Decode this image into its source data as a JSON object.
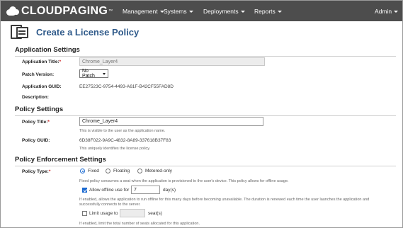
{
  "navbar": {
    "brand": "CLOUDPAGING",
    "brand_mark": "™",
    "items": [
      {
        "label": "Management"
      },
      {
        "label": "Systems"
      },
      {
        "label": "Deployments"
      },
      {
        "label": "Reports"
      },
      {
        "label": "Admin"
      }
    ]
  },
  "page": {
    "title": "Create a License Policy",
    "icon": "license-documents-icon"
  },
  "application_settings": {
    "heading": "Application Settings",
    "title_label": "Application Title:",
    "title_value": "Chrome_Layer4",
    "patch_label": "Patch Version:",
    "patch_value": "No Patch",
    "guid_label": "Application GUID:",
    "guid_value": "EE27523C-9754-4493-A61F-B42CF55FAD8D",
    "description_label": "Description:"
  },
  "policy_settings": {
    "heading": "Policy Settings",
    "title_label": "Policy Title:",
    "title_value": "Chrome_Layer4",
    "title_hint": "This is visible to the user as the application name.",
    "guid_label": "Policy GUID:",
    "guid_value": "6D38F022-9A9C-4832-8A89-337618B37F83",
    "guid_hint": "This uniquely identifies the license policy."
  },
  "enforcement": {
    "heading": "Policy Enforcement Settings",
    "type_label": "Policy Type:",
    "types": [
      {
        "label": "Fixed",
        "selected": true
      },
      {
        "label": "Floating",
        "selected": false
      },
      {
        "label": "Metered-only",
        "selected": false
      }
    ],
    "type_hint": "Fixed policy consumes a seat when the application is provisioned to the user's device. This policy allows for offline usage.",
    "offline_label": "Allow offline use for",
    "offline_checked": true,
    "offline_value": "7",
    "offline_unit": "day(s)",
    "offline_hint": "If enabled, allows the application to run offline for this many days before becoming unavailable. The duration is renewed each time the user launches the application and successfully connects to the server.",
    "limit_label": "Limit usage to",
    "limit_checked": false,
    "limit_value": "",
    "limit_unit": "seat(s)",
    "limit_hint": "If enabled, limit the total number of seats allocated for this application."
  },
  "colors": {
    "navbar_bg": "#4d4d4d",
    "title": "#2f5a8a",
    "required": "#cc2222",
    "accent": "#1b6ad1"
  }
}
